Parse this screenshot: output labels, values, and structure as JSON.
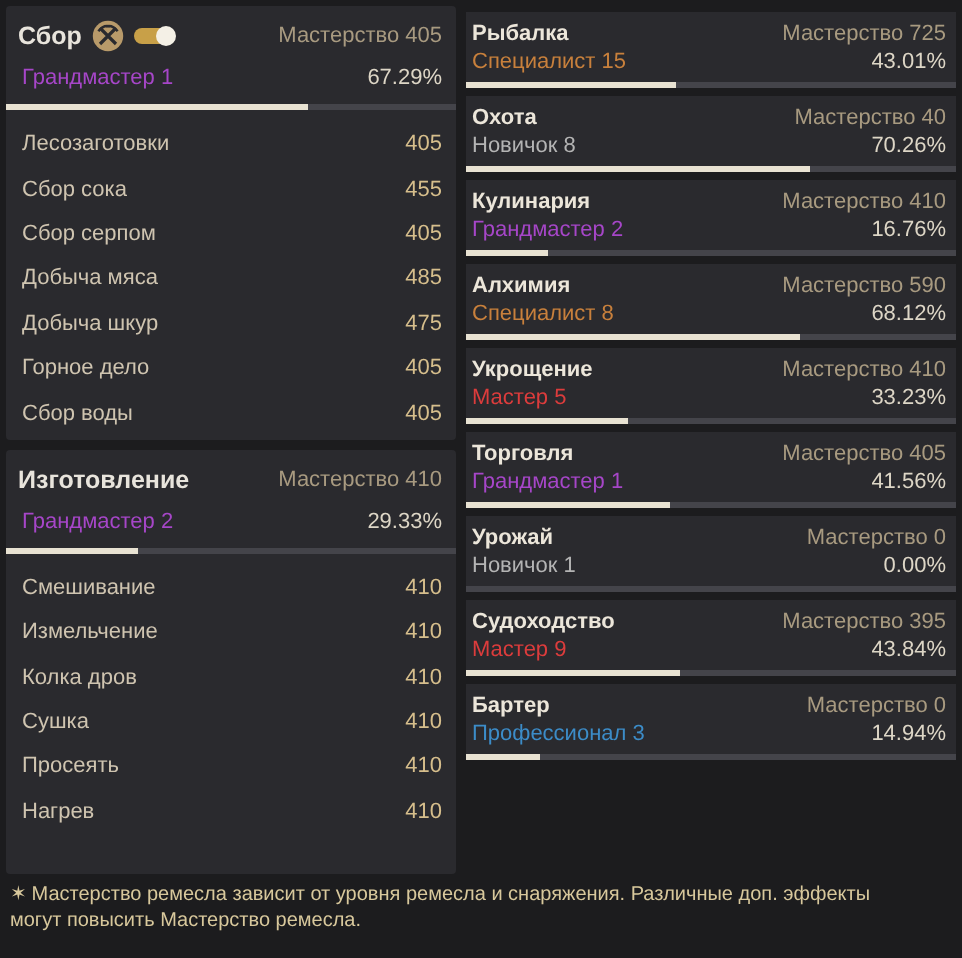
{
  "left_sections": [
    {
      "kind": "with_toggle",
      "title": "Сбор",
      "toggle": {
        "on": true
      },
      "mastery": "Мастерство 405",
      "rank": "Грандмастер 1",
      "color": "#a646c8",
      "percent": "67.29%",
      "level": 0.6729,
      "items": [
        {
          "name": "Лесозаготовки",
          "value": "405"
        },
        {
          "name": "Сбор сока",
          "value": "455"
        },
        {
          "name": "Сбор серпом",
          "value": "405"
        },
        {
          "name": "Добыча мяса",
          "value": "485"
        },
        {
          "name": "Добыча шкур",
          "value": "475"
        },
        {
          "name": "Горное дело",
          "value": "405"
        },
        {
          "name": "Сбор воды",
          "value": "405"
        }
      ]
    },
    {
      "kind": "plain",
      "title": "Изготовление",
      "mastery": "Мастерство 410",
      "rank": "Грандмастер 2",
      "color": "#a646c8",
      "percent": "29.33%",
      "level": 0.2933,
      "items": [
        {
          "name": "Смешивание",
          "value": "410"
        },
        {
          "name": "Измельчение",
          "value": "410"
        },
        {
          "name": "Колка дров",
          "value": "410"
        },
        {
          "name": "Сушка",
          "value": "410"
        },
        {
          "name": "Просеять",
          "value": "410"
        },
        {
          "name": "Нагрев",
          "value": "410"
        }
      ]
    }
  ],
  "skills": [
    {
      "name": "Рыбалка",
      "mastery": "Мастерство 725",
      "rank": "Специалист 15",
      "color": "#c8803c",
      "percent": "43.01%",
      "level": 0.4301
    },
    {
      "name": "Охота",
      "mastery": "Мастерство 40",
      "rank": "Новичок 8",
      "color": "#b4b4b4",
      "percent": "70.26%",
      "level": 0.7026
    },
    {
      "name": "Кулинария",
      "mastery": "Мастерство 410",
      "rank": "Грандмастер 2",
      "color": "#a646c8",
      "percent": "16.76%",
      "level": 0.1676
    },
    {
      "name": "Алхимия",
      "mastery": "Мастерство 590",
      "rank": "Специалист 8",
      "color": "#c8803c",
      "percent": "68.12%",
      "level": 0.6812
    },
    {
      "name": "Укрощение",
      "mastery": "Мастерство 410",
      "rank": "Мастер 5",
      "color": "#dc3c3c",
      "percent": "33.23%",
      "level": 0.3323
    },
    {
      "name": "Торговля",
      "mastery": "Мастерство 405",
      "rank": "Грандмастер 1",
      "color": "#a646c8",
      "percent": "41.56%",
      "level": 0.4156
    },
    {
      "name": "Урожай",
      "mastery": "Мастерство 0",
      "rank": "Новичок 1",
      "color": "#b4b4b4",
      "percent": "0.00%"
    },
    {
      "name": "Судоходство",
      "mastery": "Мастерство 395",
      "rank": "Мастер 9",
      "color": "#dc3c3c",
      "percent": "43.84%",
      "level": 0.4384
    },
    {
      "name": "Бартер",
      "mastery": "Мастерство 0",
      "rank": "Профессионал 3",
      "color": "#3c8cc8",
      "percent": "14.94%",
      "level": 0.1494
    }
  ],
  "footnote": "✶ Мастерство ремесла зависит от уровня ремесла и снаряжения. Различные доп. эффекты могут повысить Мастерство ремесла."
}
